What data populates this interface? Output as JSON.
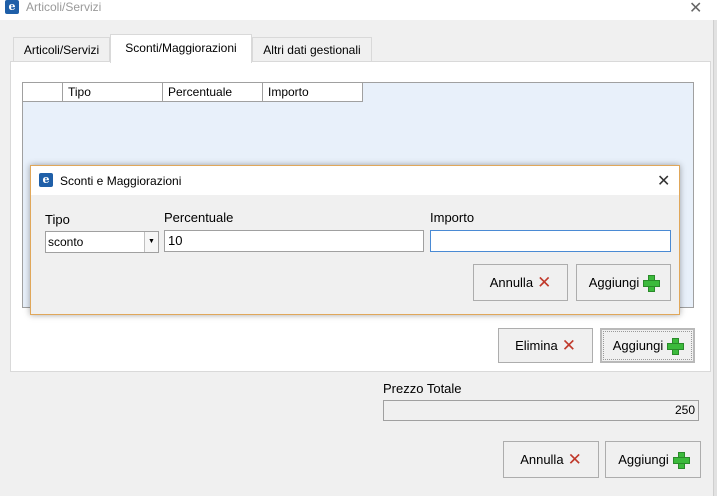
{
  "window": {
    "title": "Articoli/Servizi",
    "icon_letter": "e",
    "close_symbol": "✕"
  },
  "tabs": [
    {
      "label": "Articoli/Servizi",
      "active": false
    },
    {
      "label": "Sconti/Maggiorazioni",
      "active": true
    },
    {
      "label": "Altri dati gestionali",
      "active": false
    }
  ],
  "grid": {
    "columns": [
      "",
      "Tipo",
      "Percentuale",
      "Importo"
    ],
    "rows": []
  },
  "panel_buttons": {
    "delete_label": "Elimina",
    "add_label": "Aggiungi"
  },
  "total": {
    "label": "Prezzo Totale",
    "value": "250"
  },
  "footer_buttons": {
    "cancel_label": "Annulla",
    "add_label": "Aggiungi"
  },
  "dialog": {
    "title": "Sconti e Maggiorazioni",
    "icon_letter": "e",
    "close_symbol": "✕",
    "tipo_label": "Tipo",
    "tipo_value": "sconto",
    "percentuale_label": "Percentuale",
    "percentuale_value": "10",
    "importo_label": "Importo",
    "importo_value": "",
    "cancel_label": "Annulla",
    "add_label": "Aggiungi"
  },
  "colors": {
    "accent": "#1f5fa8",
    "dialog_border": "#e0a75a",
    "cancel_icon": "#c0392b",
    "add_icon": "#3cba3c"
  },
  "icons": [
    "app-logo-icon",
    "close-icon",
    "cancel-x-icon",
    "add-plus-icon",
    "dropdown-arrow-icon"
  ]
}
